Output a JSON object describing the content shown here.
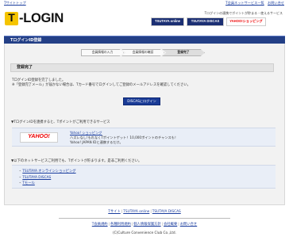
{
  "topnav": {
    "left_link": "Tサイトトップ",
    "right_links": [
      "T会員ネットサービス一覧",
      "お問い合せ"
    ]
  },
  "header": {
    "logo_mark": "T",
    "logo_text": "-LOGIN",
    "tagline": "Tログインの連携でポイントが貯まる・使えるサービス",
    "banners": [
      "TSUTAYA online",
      "TSUTAYA DISCAS",
      "YAHOO!ショッピング"
    ]
  },
  "page": {
    "title": "TログインID登録",
    "steps": [
      "会員情報の入力",
      "会員情報の確認",
      "登録完了"
    ],
    "active_step": 2,
    "section_title": "登録完了",
    "message_lines": [
      "TログインID登録を完了しました。",
      "※「登録完了メール」が届かない場合は、Tカード番号でログインしてご登録のメールアドレスを確認してください。"
    ],
    "discas_button": "DISCASにログイン",
    "yahoo_intro": "▼TログインIDを連携すると、Tポイントがご利用できるサービス",
    "yahoo_logo": "YAHOO!",
    "yahoo_link": "Yahoo! ショッピング",
    "yahoo_desc_lines": [
      "ハズレなし!もれなくTポイントゲット！10,000ポイントのチャンスも！",
      "Yahoo! JAPAN IDと連携するだけ。"
    ],
    "services_intro": "▼以下のネットサービスご利用でも、Tポイントが貯まります。是非ご利用ください。",
    "services": [
      "TSUTAYA オンラインショッピング",
      "TSUTAYA DISCAS",
      "Tモール"
    ]
  },
  "footer": {
    "links1": [
      "Tサイト",
      "TSUTAYA online",
      "TSUTAYA DISCAS"
    ],
    "links2": [
      "T会員規約",
      "各種利用規約",
      "個人情報保護方針",
      "会社概要",
      "お問い合せ"
    ],
    "copyright": "(C)Culture Convenience Club Co.,Ltd."
  },
  "colors": {
    "titlebar": "#233f86",
    "link": "#1a3d9e",
    "logo_yellow": "#f5c400"
  }
}
